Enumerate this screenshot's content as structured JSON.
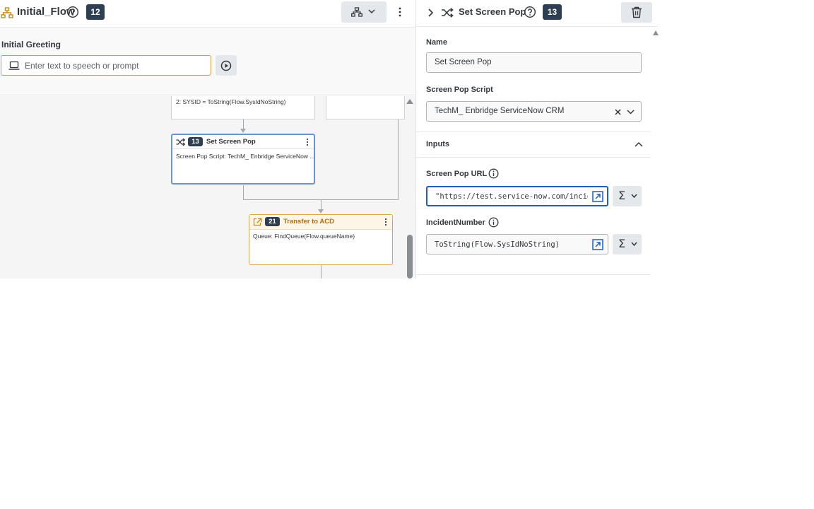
{
  "flow": {
    "title": "Initial_Flow",
    "badge": "12"
  },
  "greeting": {
    "label": "Initial Greeting",
    "placeholder": "Enter text to speech or prompt"
  },
  "canvas": {
    "partial_node_text": "2: SYSID = ToString(Flow.SysIdNoString)",
    "nodes": [
      {
        "badge": "13",
        "title": "Set Screen Pop",
        "body": "Screen Pop Script: TechM_ Enbridge ServiceNow ..."
      },
      {
        "badge": "21",
        "title": "Transfer to ACD",
        "body": "Queue: FindQueue(Flow.queueName)"
      }
    ]
  },
  "panel": {
    "title": "Set Screen Pop",
    "badge": "13",
    "name_label": "Name",
    "name_value": "Set Screen Pop",
    "script_label": "Screen Pop Script",
    "script_value": "TechM_ Enbridge ServiceNow CRM",
    "inputs_label": "Inputs",
    "url_label": "Screen Pop URL",
    "url_value": "\"https://test.service-now.com/inciden",
    "incident_label": "IncidentNumber",
    "incident_value": "ToString(Flow.SysIdNoString)",
    "sigma": "Σ"
  },
  "colors": {
    "badge_bg": "#2e3f53",
    "selected_border": "#6a94c7",
    "acd_accent": "#d7a845",
    "acd_title": "#b46c10",
    "focus_blue": "#1f5fb5"
  },
  "icons": [
    "flow-icon",
    "help-icon",
    "layout-icon",
    "chevron-down-icon",
    "kebab-icon",
    "laptop-icon",
    "play-icon",
    "shuffle-icon",
    "transfer-icon",
    "chevron-right-icon",
    "trash-icon",
    "clear-icon",
    "chevron-up-icon",
    "info-icon",
    "expand-icon"
  ]
}
